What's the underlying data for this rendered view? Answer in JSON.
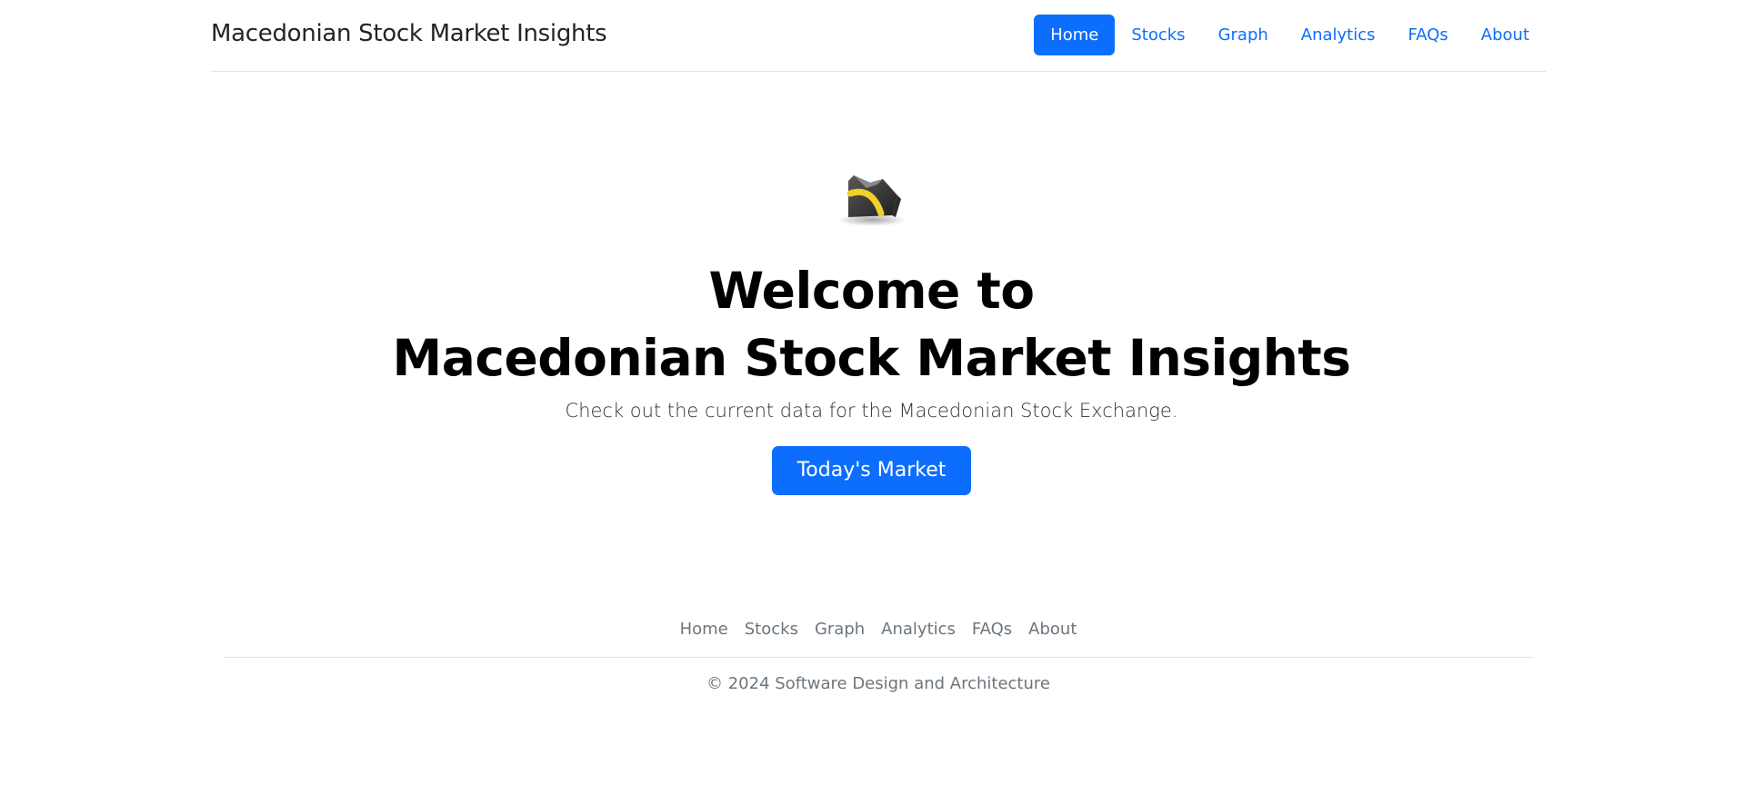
{
  "header": {
    "brand": "Macedonian Stock Market Insights",
    "nav": [
      {
        "label": "Home",
        "active": true
      },
      {
        "label": "Stocks",
        "active": false
      },
      {
        "label": "Graph",
        "active": false
      },
      {
        "label": "Analytics",
        "active": false
      },
      {
        "label": "FAQs",
        "active": false
      },
      {
        "label": "About",
        "active": false
      }
    ]
  },
  "hero": {
    "logo_icon": "mse-logo-icon",
    "title_line1": "Welcome to",
    "title_line2": "Macedonian Stock Market Insights",
    "subtitle": "Check out the current data for the Macedonian Stock Exchange.",
    "cta_label": "Today's Market"
  },
  "footer": {
    "nav": [
      "Home",
      "Stocks",
      "Graph",
      "Analytics",
      "FAQs",
      "About"
    ],
    "copyright": "© 2024 Software Design and Architecture"
  },
  "colors": {
    "accent": "#0d6efd",
    "muted": "#6c757d",
    "border": "#dee2e6",
    "logo_yellow": "#f2d02b"
  }
}
